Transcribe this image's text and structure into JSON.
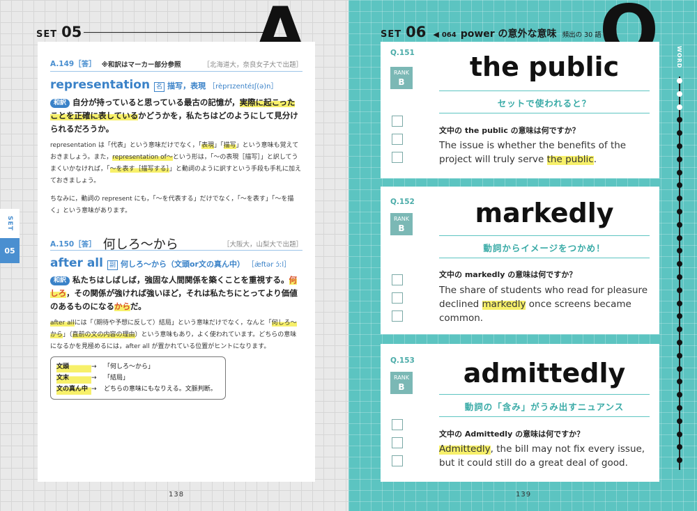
{
  "left": {
    "set_word": "SET",
    "set_num": "05",
    "big_letter": "A",
    "page_num": "138",
    "tab": {
      "label": "SET",
      "num": "05"
    },
    "a149": {
      "label": "A.149［答］",
      "note": "※和訳はマーカー部分参照",
      "source": "［北海道大，奈良女子大で出題］",
      "headword": "representation",
      "pos": "名",
      "meaning": "描写，表現",
      "pron": "［rèprɪzentéɪʃ(ə)n］",
      "wayaku": "和訳",
      "trans_1": "自分が持っていると思っている最古の記憶が，",
      "trans_hl1": "実際に起こったことを",
      "trans_hl2": "正確に表している",
      "trans_2": "かどうかを，私たちはどのようにして見分けられるだろうか。",
      "expl_1a": "representation は「代表」という意味だけでなく，「",
      "expl_1b": "表現",
      "expl_1c": "」「",
      "expl_1d": "描写",
      "expl_1e": "」という意味も覚えておきましょう。また，",
      "expl_1f": "representation of～",
      "expl_1g": "という形は，「～の表現［描写］」と訳してうまくいかなければ，「",
      "expl_1h": "～を表す［描写する］",
      "expl_1i": "」と動詞のように訳すという手段も手札に加えておきましょう。",
      "expl_2": "ちなみに，動詞の represent にも，「～を代表する」だけでなく，「～を表す」「～を描く」という意味があります。"
    },
    "a150": {
      "label": "A.150［答］",
      "answer": "何しろ～から",
      "source": "［大阪大，山梨大で出題］",
      "headword": "after all",
      "pos": "副",
      "meaning": "何しろ～から（文頭or文の真ん中）",
      "pron": "［æ̀ftər ɔ́ːl］",
      "wayaku": "和訳",
      "trans_1": "私たちはしばしば，強固な人間関係を築くことを重視する。",
      "trans_o1": "何しろ",
      "trans_2": "，その関係が強ければ強いほど，それは私たちにとってより価値のあるものになる",
      "trans_o2": "から",
      "trans_3": "だ。",
      "expl_a": "after all",
      "expl_b": "には「（期待や予想に反して）結局」という意味だけでなく，なんと「",
      "expl_c": "何しろ～から",
      "expl_d": "」（",
      "expl_e": "直前の文の内容の理由",
      "expl_f": "）という意味もあり，よく使われています。どちらの意味になるかを見極めるには，after all が置かれている位置がヒントになります。",
      "table": [
        {
          "key": "文頭",
          "arrow": "→",
          "val": "「何しろ～から」"
        },
        {
          "key": "文末",
          "arrow": "→",
          "val": "「結局」"
        },
        {
          "key": "文の真ん中",
          "arrow": "→",
          "val": "どちらの意味にもなりえる。文脈判断。"
        }
      ]
    }
  },
  "right": {
    "set_word": "SET",
    "set_num": "06",
    "speaker": "◀",
    "header_num": "064",
    "header_title": "power の意外な意味",
    "header_sub": "頻出の 30 語",
    "big_letter": "Q",
    "page_num": "139",
    "side_label": "WORD",
    "questions": [
      {
        "num": "Q.151",
        "rank_label": "RANK",
        "rank": "B",
        "word": "the public",
        "hint": "セットで使われると？",
        "question": "文中の the public の意味は何ですか？",
        "sentence_pre": "The issue is whether the benefits of the project will truly serve ",
        "sentence_hl": "the public",
        "sentence_post": "."
      },
      {
        "num": "Q.152",
        "rank_label": "RANK",
        "rank": "B",
        "word": "markedly",
        "hint": "動詞からイメージをつかめ！",
        "question": "文中の markedly の意味は何ですか？",
        "sentence_pre": "The share of students who read for pleasure declined ",
        "sentence_hl": "markedly",
        "sentence_post": " once screens became common."
      },
      {
        "num": "Q.153",
        "rank_label": "RANK",
        "rank": "B",
        "word": "admittedly",
        "hint": "動詞の「含み」がうみ出すニュアンス",
        "question": "文中の Admittedly の意味は何ですか？",
        "sentence_pre": "",
        "sentence_hl": "Admittedly",
        "sentence_post": ", the bill may not fix every issue, but it could still do a great deal of good."
      }
    ]
  }
}
